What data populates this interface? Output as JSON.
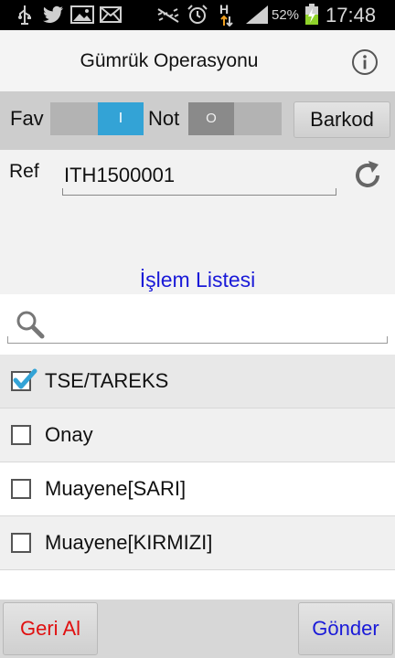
{
  "status_bar": {
    "battery_percent": "52%",
    "time": "17:48",
    "network_type": "H",
    "icons": [
      "usb-icon",
      "twitter-icon",
      "image-icon",
      "mail-icon",
      "mute-icon",
      "alarm-icon",
      "data-transfer-icon",
      "signal-icon",
      "battery-charging-icon"
    ]
  },
  "action_bar": {
    "title": "Gümrük Operasyonu",
    "info_icon": "info-icon"
  },
  "toggles": {
    "fav_label": "Fav",
    "fav_state": "I",
    "not_label": "Not",
    "not_state": "O",
    "barcode_button": "Barkod"
  },
  "ref": {
    "label": "Ref",
    "value": "ITH1500001",
    "refresh_icon": "refresh-icon"
  },
  "section": {
    "title": "İşlem Listesi"
  },
  "search": {
    "placeholder": "",
    "icon": "search-icon"
  },
  "items": [
    {
      "label": "TSE/TAREKS",
      "checked": true
    },
    {
      "label": "Onay",
      "checked": false
    },
    {
      "label": "Muayene[SARI]",
      "checked": false
    },
    {
      "label": "Muayene[KIRMIZI]",
      "checked": false
    }
  ],
  "footer": {
    "undo_button": "Geri Al",
    "send_button": "Gönder"
  },
  "colors": {
    "accent_blue": "#33a3d6",
    "title_blue": "#1a1ad8",
    "undo_red": "#e01010",
    "send_blue": "#1a1ad8"
  }
}
